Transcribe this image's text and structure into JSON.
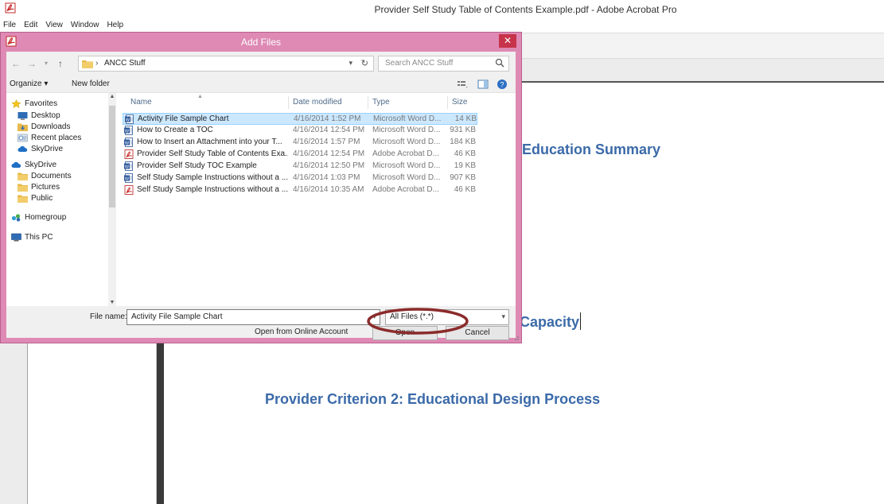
{
  "app": {
    "window_title": "Provider Self Study Table of Contents Example.pdf - Adobe Acrobat Pro",
    "menu": [
      "File",
      "Edit",
      "View",
      "Window",
      "Help"
    ]
  },
  "document": {
    "headings": [
      "Education Summary",
      "Capacity",
      "Provider Criterion 2: Educational Design Process"
    ]
  },
  "dialog": {
    "title": "Add Files",
    "close_label": "✕",
    "address_separator": "›",
    "address_path": "ANCC Stuff",
    "search_placeholder": "Search ANCC Stuff",
    "organize_label": "Organize ▾",
    "new_folder_label": "New folder",
    "tree": [
      {
        "label": "Favorites",
        "icon": "star-icon",
        "level": 0
      },
      {
        "label": "Desktop",
        "icon": "desktop-icon",
        "level": 1
      },
      {
        "label": "Downloads",
        "icon": "downloads-icon",
        "level": 1
      },
      {
        "label": "Recent places",
        "icon": "recent-places-icon",
        "level": 1
      },
      {
        "label": "SkyDrive",
        "icon": "skydrive-icon",
        "level": 1
      },
      {
        "label": "SkyDrive",
        "icon": "skydrive-icon",
        "level": 0
      },
      {
        "label": "Documents",
        "icon": "folder-icon",
        "level": 1
      },
      {
        "label": "Pictures",
        "icon": "folder-icon",
        "level": 1
      },
      {
        "label": "Public",
        "icon": "folder-icon",
        "level": 1
      },
      {
        "label": "Homegroup",
        "icon": "homegroup-icon",
        "level": 0
      },
      {
        "label": "This PC",
        "icon": "computer-icon",
        "level": 0
      }
    ],
    "columns": {
      "name": "Name",
      "date": "Date modified",
      "type": "Type",
      "size": "Size"
    },
    "files": [
      {
        "name": "Activity File Sample Chart",
        "date": "4/16/2014 1:52 PM",
        "type": "Microsoft Word D...",
        "size": "14 KB",
        "icon": "word",
        "selected": true
      },
      {
        "name": "How to Create a TOC",
        "date": "4/16/2014 12:54 PM",
        "type": "Microsoft Word D...",
        "size": "931 KB",
        "icon": "word",
        "selected": false
      },
      {
        "name": "How to Insert an Attachment into your T...",
        "date": "4/16/2014 1:57 PM",
        "type": "Microsoft Word D...",
        "size": "184 KB",
        "icon": "word",
        "selected": false
      },
      {
        "name": "Provider Self Study Table of Contents Exa...",
        "date": "4/16/2014 12:54 PM",
        "type": "Adobe Acrobat D...",
        "size": "46 KB",
        "icon": "pdf",
        "selected": false
      },
      {
        "name": "Provider Self Study TOC Example",
        "date": "4/16/2014 12:50 PM",
        "type": "Microsoft Word D...",
        "size": "19 KB",
        "icon": "word",
        "selected": false
      },
      {
        "name": "Self Study Sample Instructions without a ...",
        "date": "4/16/2014 1:03 PM",
        "type": "Microsoft Word D...",
        "size": "907 KB",
        "icon": "word",
        "selected": false
      },
      {
        "name": "Self Study Sample Instructions without a ...",
        "date": "4/16/2014 10:35 AM",
        "type": "Adobe Acrobat D...",
        "size": "46 KB",
        "icon": "pdf",
        "selected": false
      }
    ],
    "file_name_label": "File name:",
    "file_name_value": "Activity File Sample Chart",
    "file_type_value": "All Files (*.*)",
    "open_online_label": "Open from Online Account",
    "open_label": "Open",
    "cancel_label": "Cancel"
  },
  "colors": {
    "dialog_frame": "#de8ab4",
    "heading_blue": "#3b6aa8",
    "selection": "#cce8ff",
    "annotation": "#8b2b2b"
  }
}
